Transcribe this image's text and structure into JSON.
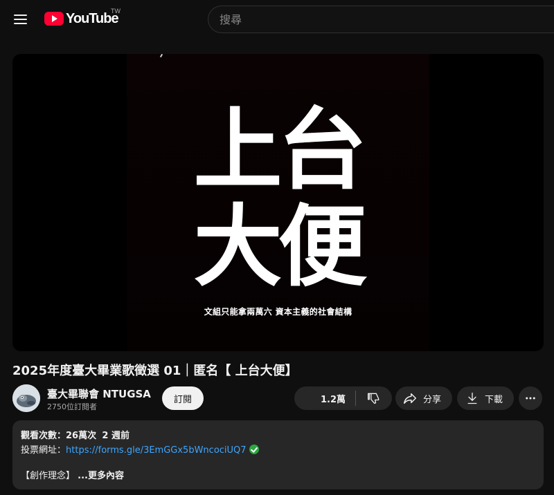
{
  "header": {
    "logo_text": "YouTube",
    "country_code": "TW",
    "search_placeholder": "搜尋"
  },
  "video": {
    "art_line1": "上台",
    "art_line2": "大便",
    "art_subtitle": "文組只能拿兩萬六 資本主義的社會結構",
    "title": "2025年度臺大畢業歌徵選 01｜匿名【 上台大便】"
  },
  "channel": {
    "name": "臺大畢聯會 NTUGSA",
    "subscribers": "2750位訂閱者",
    "subscribe_label": "訂閱"
  },
  "actions": {
    "like_count": "1.2萬",
    "share_label": "分享",
    "download_label": "下載"
  },
  "description": {
    "views_label": "觀看次數：",
    "views_value": "26萬次",
    "time_ago": "2 週前",
    "vote_label": "投票網址：",
    "vote_link": "https://forms.gle/3EmGGx5bWncociUQ7",
    "concept_label": "【創作理念】",
    "more_label": "...更多內容"
  },
  "colors": {
    "background": "#0f0f0f",
    "pill": "#272727",
    "youtube_red": "#ff0033",
    "link": "#3ea6ff",
    "check": "#2ba640"
  }
}
